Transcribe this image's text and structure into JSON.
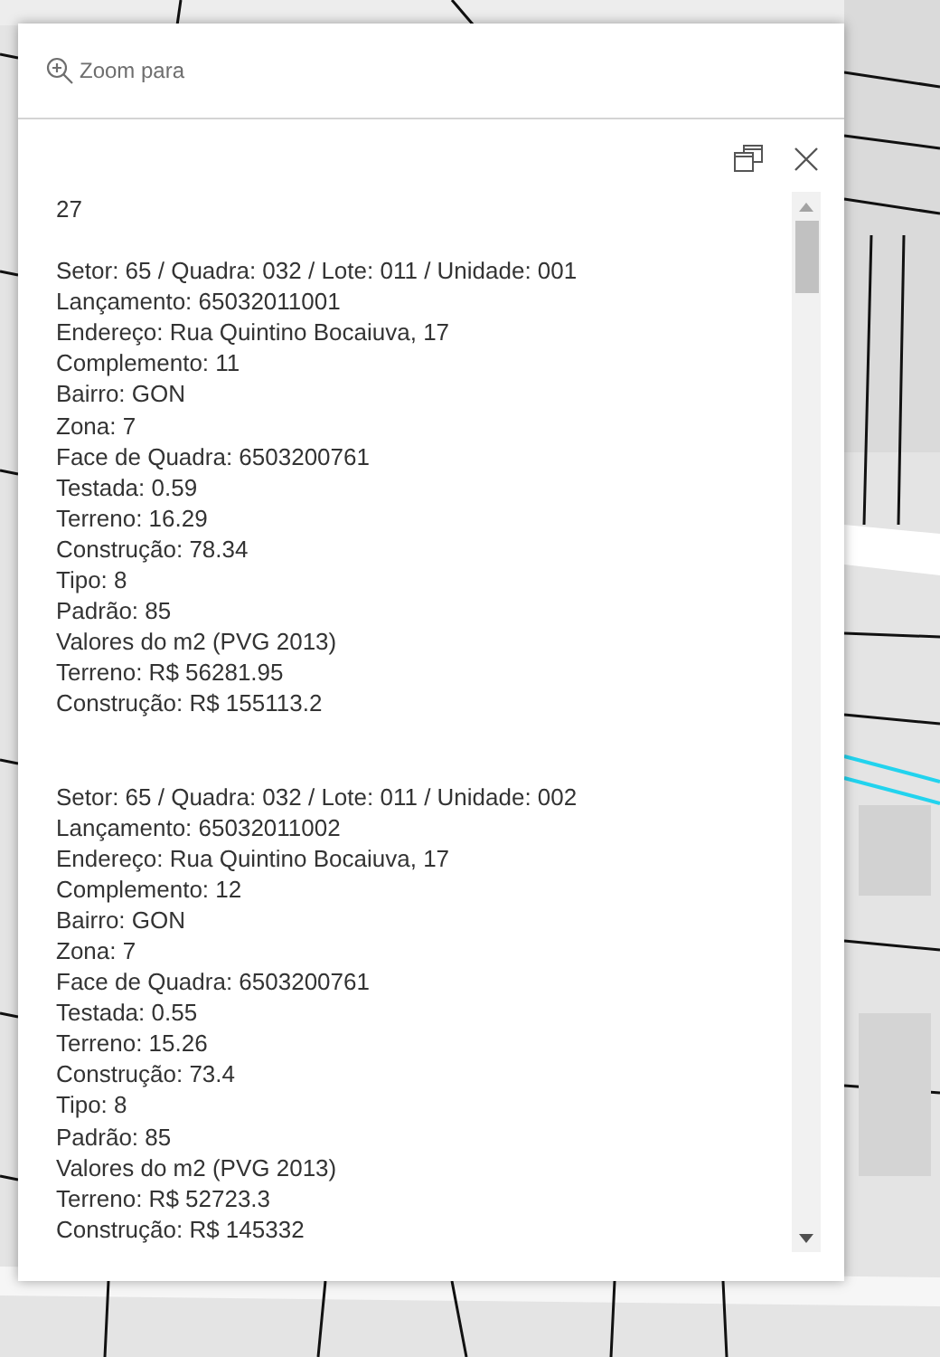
{
  "popup": {
    "zoom_action": "Zoom para",
    "title": "27",
    "records": [
      {
        "lines": [
          "Setor: 65 / Quadra: 032 / Lote: 011 / Unidade: 001",
          "Lançamento: 65032011001",
          "Endereço: Rua Quintino Bocaiuva, 17",
          "Complemento: 11",
          "Bairro: GON",
          "Zona: 7",
          "Face de Quadra: 6503200761",
          "Testada: 0.59",
          "Terreno: 16.29",
          "Construção: 78.34",
          "Tipo: 8",
          "Padrão: 85",
          "Valores do m2 (PVG 2013)",
          "Terreno: R$ 56281.95",
          "Construção: R$ 155113.2"
        ]
      },
      {
        "lines": [
          "Setor: 65 / Quadra: 032 / Lote: 011 / Unidade: 002",
          "Lançamento: 65032011002",
          "Endereço: Rua Quintino Bocaiuva, 17",
          "Complemento: 12",
          "Bairro: GON",
          "Zona: 7",
          "Face de Quadra: 6503200761",
          "Testada: 0.55",
          "Terreno: 15.26",
          "Construção: 73.4",
          "Tipo: 8",
          "Padrão: 85",
          "Valores do m2 (PVG 2013)",
          "Terreno: R$ 52723.3",
          "Construção: R$ 145332"
        ]
      }
    ]
  }
}
